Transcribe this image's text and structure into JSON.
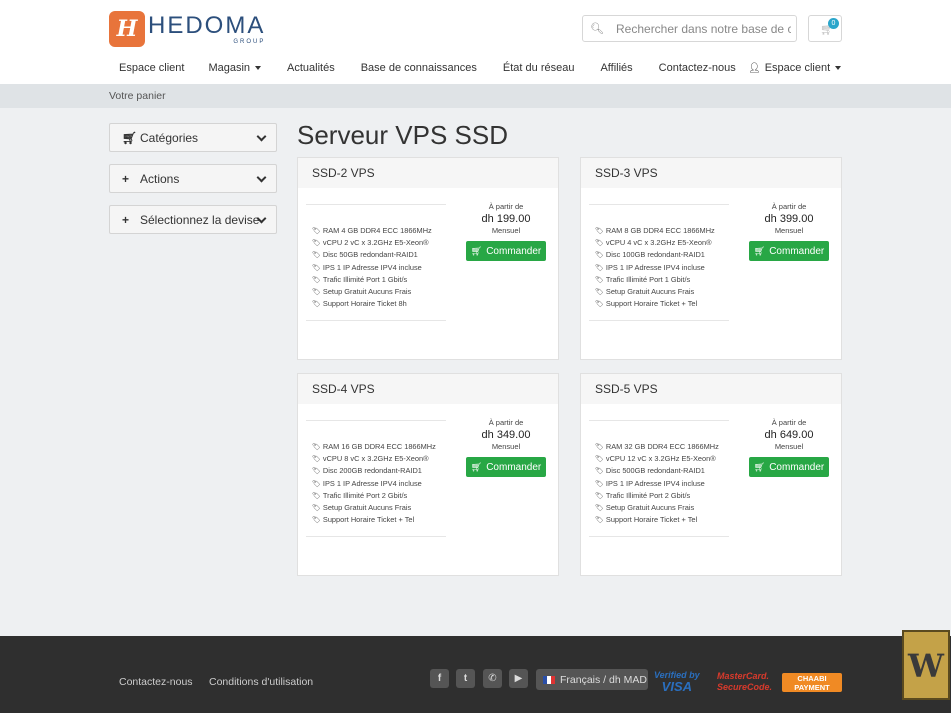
{
  "brand": {
    "logo_letter": "H",
    "name": "HEDOMA",
    "tagline": "GROUP"
  },
  "search": {
    "placeholder": "Rechercher dans notre base de connaissances..."
  },
  "cart": {
    "count": "0"
  },
  "nav": {
    "items": [
      {
        "label": "Espace client"
      },
      {
        "label": "Magasin",
        "dropdown": true
      },
      {
        "label": "Actualités"
      },
      {
        "label": "Base de connaissances"
      },
      {
        "label": "État du réseau"
      },
      {
        "label": "Affiliés"
      },
      {
        "label": "Contactez-nous"
      }
    ],
    "client_menu": "Espace client"
  },
  "breadcrumb": "Votre panier",
  "sidebar": {
    "categories": "Catégories",
    "actions": "Actions",
    "currency": "Sélectionnez la devise"
  },
  "page_title": "Serveur VPS SSD",
  "products": [
    {
      "name": "SSD-2 VPS",
      "features": [
        "RAM 4 GB DDR4 ECC 1866MHz",
        "vCPU 2 vC x 3.2GHz E5-Xeon®",
        "Disc 50GB redondant-RAID1",
        "IPS 1 IP Adresse IPV4 incluse",
        "Trafic Illimité Port 1 Gbit/s",
        "Setup Gratuit Aucuns Frais",
        "Support Horaire Ticket 8h"
      ],
      "from": "À partir de",
      "price": "dh 199.00",
      "cycle": "Mensuel",
      "button": "Commander"
    },
    {
      "name": "SSD-3 VPS",
      "features": [
        "RAM 8 GB DDR4 ECC 1866MHz",
        "vCPU 4 vC x 3.2GHz E5-Xeon®",
        "Disc 100GB redondant-RAID1",
        "IPS 1 IP Adresse IPV4 incluse",
        "Trafic Illimité Port 1 Gbit/s",
        "Setup Gratuit Aucuns Frais",
        "Support Horaire Ticket + Tel"
      ],
      "from": "À partir de",
      "price": "dh 399.00",
      "cycle": "Mensuel",
      "button": "Commander"
    },
    {
      "name": "SSD-4 VPS",
      "features": [
        "RAM 16 GB DDR4 ECC 1866MHz",
        "vCPU 8 vC x 3.2GHz E5-Xeon®",
        "Disc 200GB redondant-RAID1",
        "IPS 1 IP Adresse IPV4 incluse",
        "Trafic Illimité Port 2 Gbit/s",
        "Setup Gratuit Aucuns Frais",
        "Support Horaire Ticket + Tel"
      ],
      "from": "À partir de",
      "price": "dh 349.00",
      "cycle": "Mensuel",
      "button": "Commander"
    },
    {
      "name": "SSD-5 VPS",
      "features": [
        "RAM 32 GB DDR4 ECC 1866MHz",
        "vCPU 12 vC x 3.2GHz E5-Xeon®",
        "Disc 500GB redondant-RAID1",
        "IPS 1 IP Adresse IPV4 incluse",
        "Trafic Illimité Port 2 Gbit/s",
        "Setup Gratuit Aucuns Frais",
        "Support Horaire Ticket + Tel"
      ],
      "from": "À partir de",
      "price": "dh 649.00",
      "cycle": "Mensuel",
      "button": "Commander"
    }
  ],
  "footer": {
    "links": [
      "Contactez-nous",
      "Conditions d'utilisation"
    ],
    "language": "Français / dh MAD",
    "payment_logos": {
      "visa_line1": "Verified by",
      "visa_line2": "VISA",
      "mastercard_line1": "MasterCard.",
      "mastercard_line2": "SecureCode.",
      "chaabi_line1": "CHAABI",
      "chaabi_line2": "PAYMENT"
    }
  },
  "colors": {
    "accent": "#28a745",
    "brand": "#e8743b",
    "brand_text": "#2c4f7c",
    "badge": "#2ba6cb"
  }
}
